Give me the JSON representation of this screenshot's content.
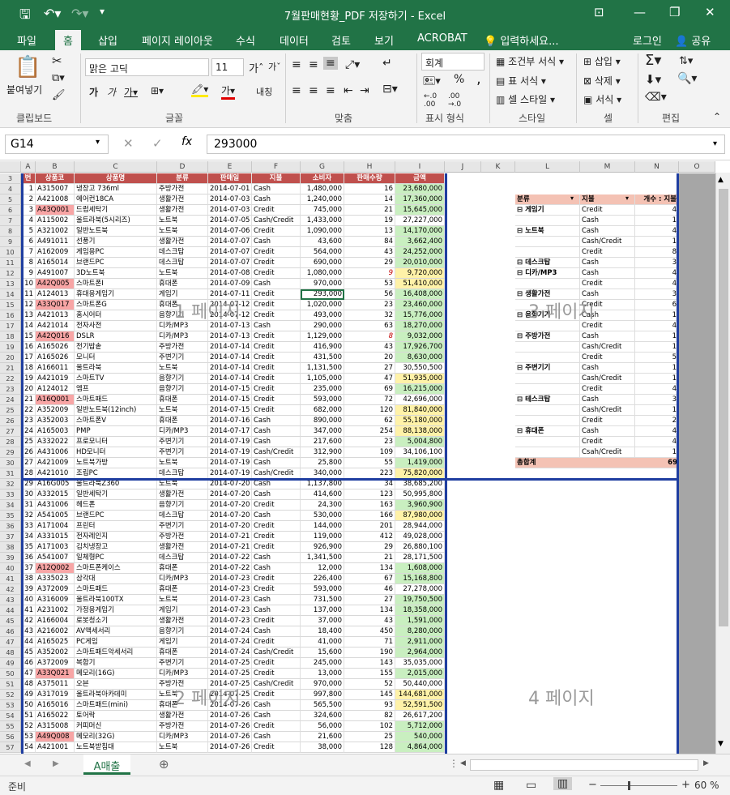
{
  "window": {
    "title": "7월판매현황_PDF 저장하기 - Excel",
    "brand_color": "#217346"
  },
  "tabs": [
    "파일",
    "홈",
    "삽입",
    "페이지 레이아웃",
    "수식",
    "데이터",
    "검토",
    "보기",
    "ACROBAT"
  ],
  "tell_me": "입력하세요...",
  "account": {
    "login": "로그인",
    "share": "공유"
  },
  "ribbon": {
    "paste": "붙여넣기",
    "clipboard": "클립보드",
    "font_name": "맑은 고딕",
    "font_size": "11",
    "font_group": "글꼴",
    "align_group": "맞춤",
    "wrap": "내칭",
    "number_format": "회계",
    "number_group": "표시 형식",
    "percent": "%",
    "comma": ",",
    "cond_format": "조건부 서식",
    "table_format": "표 서식",
    "cell_style": "셀 스타일",
    "style_group": "스타일",
    "insert": "삽입",
    "delete": "삭제",
    "format": "서식",
    "cells_group": "셀",
    "editing_group": "편집"
  },
  "formula_bar": {
    "name_box": "G14",
    "value": "293000"
  },
  "columns": [
    "A",
    "B",
    "C",
    "D",
    "E",
    "F",
    "G",
    "H",
    "I",
    "J",
    "K",
    "L",
    "M",
    "N",
    "O"
  ],
  "headers": [
    "번",
    "상품코",
    "상품명",
    "분류",
    "판매일",
    "지불",
    "소비자",
    "판매수량",
    "금액"
  ],
  "rows": [
    [
      "1",
      "A315007",
      "냉장고 736ml",
      "주방가전",
      "2014-07-01",
      "Cash",
      "1,480,000",
      "16",
      "23,680,000",
      "g"
    ],
    [
      "2",
      "A421008",
      "에어컨18CA",
      "생활가전",
      "2014-07-03",
      "Cash",
      "1,240,000",
      "14",
      "17,360,000",
      "g"
    ],
    [
      "3",
      "A43Q001",
      "드럼세탁기",
      "생활가전",
      "2014-07-03",
      "Credit",
      "745,000",
      "21",
      "15,645,000",
      "g"
    ],
    [
      "4",
      "A115002",
      "울트라북(5시리즈)",
      "노트북",
      "2014-07-05",
      "Cash/Credit",
      "1,433,000",
      "19",
      "27,227,000",
      ""
    ],
    [
      "5",
      "A321002",
      "일반노트북",
      "노트북",
      "2014-07-06",
      "Credit",
      "1,090,000",
      "13",
      "14,170,000",
      "g"
    ],
    [
      "6",
      "A491011",
      "선풍기",
      "생활가전",
      "2014-07-07",
      "Cash",
      "43,600",
      "84",
      "3,662,400",
      "g"
    ],
    [
      "7",
      "A162009",
      "게임용PC",
      "데스크탑",
      "2014-07-07",
      "Credit",
      "564,000",
      "43",
      "24,252,000",
      "g"
    ],
    [
      "8",
      "A165014",
      "브랜드PC",
      "데스크탑",
      "2014-07-07",
      "Credit",
      "690,000",
      "29",
      "20,010,000",
      "g"
    ],
    [
      "9",
      "A491007",
      "3D노트북",
      "노트북",
      "2014-07-08",
      "Credit",
      "1,080,000",
      "9",
      "9,720,000",
      "y"
    ],
    [
      "10",
      "A42Q005",
      "스마트폰I",
      "휴대폰",
      "2014-07-09",
      "Cash",
      "970,000",
      "53",
      "51,410,000",
      "y"
    ],
    [
      "11",
      "A124013",
      "휴대용게임기",
      "게임기",
      "2014-07-11",
      "Credit",
      "293,000",
      "56",
      "16,408,000",
      "g"
    ],
    [
      "12",
      "A33Q017",
      "스마트폰G",
      "휴대폰",
      "2014-07-12",
      "Credit",
      "1,020,000",
      "23",
      "23,460,000",
      "g"
    ],
    [
      "13",
      "A421013",
      "홈시어터",
      "음향기기",
      "2014-07-12",
      "Credit",
      "493,000",
      "32",
      "15,776,000",
      "g"
    ],
    [
      "14",
      "A421014",
      "전자사전",
      "디카/MP3",
      "2014-07-13",
      "Cash",
      "290,000",
      "63",
      "18,270,000",
      "g"
    ],
    [
      "15",
      "A42Q016",
      "DSLR",
      "디카/MP3",
      "2014-07-13",
      "Credit",
      "1,129,000",
      "8",
      "9,032,000",
      "g"
    ],
    [
      "16",
      "A165026",
      "전기밥솥",
      "주방가전",
      "2014-07-14",
      "Credit",
      "416,900",
      "43",
      "17,926,700",
      "g"
    ],
    [
      "17",
      "A165026",
      "모니터",
      "주변기기",
      "2014-07-14",
      "Credit",
      "431,500",
      "20",
      "8,630,000",
      "g"
    ],
    [
      "18",
      "A166011",
      "울트라북",
      "노트북",
      "2014-07-14",
      "Credit",
      "1,131,500",
      "27",
      "30,550,500",
      ""
    ],
    [
      "19",
      "A421019",
      "스마트TV",
      "음향기기",
      "2014-07-14",
      "Credit",
      "1,105,000",
      "47",
      "51,935,000",
      "y"
    ],
    [
      "20",
      "A124012",
      "엠프",
      "음향기기",
      "2014-07-15",
      "Credit",
      "235,000",
      "69",
      "16,215,000",
      "g"
    ],
    [
      "21",
      "A16Q001",
      "스마트패드",
      "휴대폰",
      "2014-07-15",
      "Credit",
      "593,000",
      "72",
      "42,696,000",
      ""
    ],
    [
      "22",
      "A352009",
      "일반노트북(12inch)",
      "노트북",
      "2014-07-15",
      "Credit",
      "682,000",
      "120",
      "81,840,000",
      "y"
    ],
    [
      "23",
      "A352003",
      "스마트폰V",
      "휴대폰",
      "2014-07-16",
      "Cash",
      "890,000",
      "62",
      "55,180,000",
      "y"
    ],
    [
      "24",
      "A165003",
      "PMP",
      "디카/MP3",
      "2014-07-17",
      "Cash",
      "347,000",
      "254",
      "88,138,000",
      "y"
    ],
    [
      "25",
      "A332022",
      "프로모니터",
      "주변기기",
      "2014-07-19",
      "Cash",
      "217,600",
      "23",
      "5,004,800",
      "g"
    ],
    [
      "26",
      "A431006",
      "HD모니터",
      "주변기기",
      "2014-07-19",
      "Cash/Credit",
      "312,900",
      "109",
      "34,106,100",
      ""
    ],
    [
      "27",
      "A421009",
      "노트북가방",
      "노트북",
      "2014-07-19",
      "Cash",
      "25,800",
      "55",
      "1,419,000",
      "g"
    ],
    [
      "28",
      "A421010",
      "조립PC",
      "데스크탑",
      "2014-07-19",
      "Cash/Credit",
      "340,000",
      "223",
      "75,820,000",
      "y"
    ],
    [
      "29",
      "A16G005",
      "울트라북Z360",
      "노트북",
      "2014-07-20",
      "Cash",
      "1,137,800",
      "34",
      "38,685,200",
      ""
    ],
    [
      "30",
      "A332015",
      "일반세탁기",
      "생활가전",
      "2014-07-20",
      "Cash",
      "414,600",
      "123",
      "50,995,800",
      ""
    ],
    [
      "31",
      "A431006",
      "헤드폰",
      "음향기기",
      "2014-07-20",
      "Credit",
      "24,300",
      "163",
      "3,960,900",
      "g"
    ],
    [
      "32",
      "A541005",
      "브랜드PC",
      "데스크탑",
      "2014-07-20",
      "Cash",
      "530,000",
      "166",
      "87,980,000",
      "y"
    ],
    [
      "33",
      "A171004",
      "프린터",
      "주변기기",
      "2014-07-20",
      "Credit",
      "144,000",
      "201",
      "28,944,000",
      ""
    ],
    [
      "34",
      "A331015",
      "전자레인지",
      "주방가전",
      "2014-07-21",
      "Credit",
      "119,000",
      "412",
      "49,028,000",
      ""
    ],
    [
      "35",
      "A171003",
      "김치냉장고",
      "생활가전",
      "2014-07-21",
      "Credit",
      "926,900",
      "29",
      "26,880,100",
      ""
    ],
    [
      "36",
      "A541007",
      "일체형PC",
      "데스크탑",
      "2014-07-22",
      "Cash",
      "1,341,500",
      "21",
      "28,171,500",
      ""
    ],
    [
      "37",
      "A12Q002",
      "스마트폰케이스",
      "휴대폰",
      "2014-07-22",
      "Cash",
      "12,000",
      "134",
      "1,608,000",
      "g"
    ],
    [
      "38",
      "A335023",
      "삼각대",
      "디카/MP3",
      "2014-07-23",
      "Credit",
      "226,400",
      "67",
      "15,168,800",
      "g"
    ],
    [
      "39",
      "A372009",
      "스마트패드",
      "휴대폰",
      "2014-07-23",
      "Credit",
      "593,000",
      "46",
      "27,278,000",
      ""
    ],
    [
      "40",
      "A316009",
      "울트라북100TX",
      "노트북",
      "2014-07-23",
      "Cash",
      "731,500",
      "27",
      "19,750,500",
      "g"
    ],
    [
      "41",
      "A231002",
      "가정용게임기",
      "게임기",
      "2014-07-23",
      "Cash",
      "137,000",
      "134",
      "18,358,000",
      "g"
    ],
    [
      "42",
      "A166004",
      "로봇청소기",
      "생활가전",
      "2014-07-23",
      "Credit",
      "37,000",
      "43",
      "1,591,000",
      "g"
    ],
    [
      "43",
      "A216002",
      "AV액세서리",
      "음향기기",
      "2014-07-24",
      "Cash",
      "18,400",
      "450",
      "8,280,000",
      "g"
    ],
    [
      "44",
      "A165025",
      "PC게임",
      "게임기",
      "2014-07-24",
      "Credit",
      "41,000",
      "71",
      "2,911,000",
      "g"
    ],
    [
      "45",
      "A352002",
      "스마트패드악세서리",
      "휴대폰",
      "2014-07-24",
      "Cash/Credit",
      "15,600",
      "190",
      "2,964,000",
      "g"
    ],
    [
      "46",
      "A372009",
      "복합기",
      "주변기기",
      "2014-07-25",
      "Credit",
      "245,000",
      "143",
      "35,035,000",
      ""
    ],
    [
      "47",
      "A33Q021",
      "메모리(16G)",
      "디카/MP3",
      "2014-07-25",
      "Credit",
      "13,000",
      "155",
      "2,015,000",
      "g"
    ],
    [
      "48",
      "A375011",
      "오븐",
      "주방가전",
      "2014-07-25",
      "Cash/Credit",
      "970,000",
      "52",
      "50,440,000",
      ""
    ],
    [
      "49",
      "A317019",
      "울트라북아카데미",
      "노트북",
      "2014-07-25",
      "Credit",
      "997,800",
      "145",
      "144,681,000",
      "y"
    ],
    [
      "50",
      "A165016",
      "스마트패드(mini)",
      "휴대폰",
      "2014-07-26",
      "Cash",
      "565,500",
      "93",
      "52,591,500",
      "y"
    ],
    [
      "51",
      "A165022",
      "토어락",
      "생활가전",
      "2014-07-26",
      "Cash",
      "324,600",
      "82",
      "26,617,200",
      ""
    ],
    [
      "52",
      "A315008",
      "커피머신",
      "주방가전",
      "2014-07-26",
      "Credit",
      "56,000",
      "102",
      "5,712,000",
      "g"
    ],
    [
      "53",
      "A49Q008",
      "메모리(32G)",
      "디카/MP3",
      "2014-07-26",
      "Cash",
      "21,600",
      "25",
      "540,000",
      "g"
    ],
    [
      "54",
      "A421001",
      "노트북받침대",
      "노트북",
      "2014-07-26",
      "Credit",
      "38,000",
      "128",
      "4,864,000",
      "g"
    ]
  ],
  "pink_rows": [
    3,
    10,
    12,
    15,
    21,
    37,
    47,
    53
  ],
  "pivot": {
    "headers": [
      "분류",
      "지불",
      "개수 : 지불"
    ],
    "rows": [
      [
        "⊟ 게임기",
        "Credit",
        "4"
      ],
      [
        "",
        "Cash",
        "1"
      ],
      [
        "⊟ 노트북",
        "Cash",
        "4"
      ],
      [
        "",
        "Cash/Credit",
        "1"
      ],
      [
        "",
        "Credit",
        "8"
      ],
      [
        "⊟ 데스크탑",
        "Cash",
        "3"
      ],
      [
        "⊟ 디카/MP3",
        "Cash",
        "4"
      ],
      [
        "",
        "Credit",
        "4"
      ],
      [
        "⊟ 생활가전",
        "Cash",
        "3"
      ],
      [
        "",
        "Credit",
        "6"
      ],
      [
        "⊟ 음향기기",
        "Cash",
        "1"
      ],
      [
        "",
        "Credit",
        "4"
      ],
      [
        "⊟ 주방가전",
        "Cash",
        "1"
      ],
      [
        "",
        "Cash/Credit",
        "1"
      ],
      [
        "",
        "Credit",
        "5"
      ],
      [
        "⊟ 주변기기",
        "Cash",
        "1"
      ],
      [
        "",
        "Cash/Credit",
        "1"
      ],
      [
        "",
        "Credit",
        "4"
      ],
      [
        "⊟ 테스크탑",
        "Cash",
        "3"
      ],
      [
        "",
        "Cash/Credit",
        "1"
      ],
      [
        "",
        "Credit",
        "2"
      ],
      [
        "⊟ 휴대폰",
        "Cash",
        "4"
      ],
      [
        "",
        "Credit",
        "4"
      ],
      [
        "",
        "Csah/Credit",
        "1"
      ]
    ],
    "total_label": "총합계",
    "total": "69"
  },
  "watermarks": {
    "p1": "1 페이지",
    "p2": "2 페이지",
    "p3": "3 페이지",
    "p4": "4 페이지"
  },
  "sheet_tab": "A매출",
  "status": {
    "ready": "준비",
    "zoom": "60 %"
  }
}
